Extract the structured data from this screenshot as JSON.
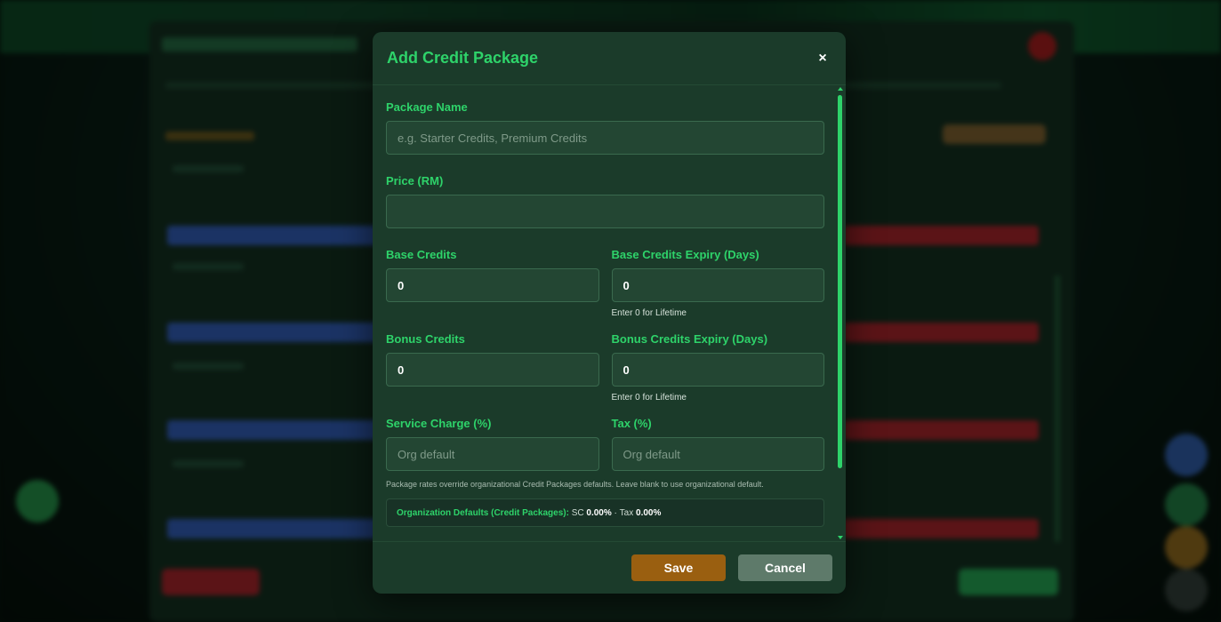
{
  "modal": {
    "title": "Add Credit Package",
    "close_label": "×"
  },
  "form": {
    "package_name": {
      "label": "Package Name",
      "placeholder": "e.g. Starter Credits, Premium Credits",
      "value": ""
    },
    "price": {
      "label": "Price (RM)",
      "placeholder": "",
      "value": ""
    },
    "base_credits": {
      "label": "Base Credits",
      "value": "0"
    },
    "base_expiry": {
      "label": "Base Credits Expiry (Days)",
      "value": "0",
      "hint": "Enter 0 for Lifetime"
    },
    "bonus_credits": {
      "label": "Bonus Credits",
      "value": "0"
    },
    "bonus_expiry": {
      "label": "Bonus Credits Expiry (Days)",
      "value": "0",
      "hint": "Enter 0 for Lifetime"
    },
    "service_charge": {
      "label": "Service Charge (%)",
      "placeholder": "Org default"
    },
    "tax": {
      "label": "Tax (%)",
      "placeholder": "Org default"
    },
    "note": "Package rates override organizational Credit Packages defaults. Leave blank to use organizational default.",
    "defaults": {
      "label": "Organization Defaults (Credit Packages):",
      "sc_prefix": "SC",
      "sc_value": "0.00%",
      "separator": "·",
      "tax_prefix": "Tax",
      "tax_value": "0.00%"
    }
  },
  "footer": {
    "save_label": "Save",
    "cancel_label": "Cancel"
  },
  "colors": {
    "accent": "#2ed36a",
    "save": "#9a5f10",
    "cancel": "#5e7a6a",
    "modal_bg": "#1b3b2a"
  }
}
